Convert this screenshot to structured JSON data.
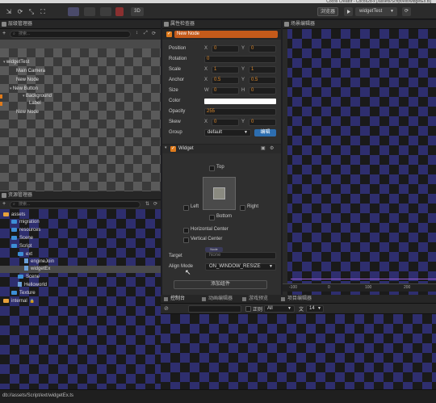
{
  "top_strip": {
    "text": "Cocos Creator - Cocos2d-x [/assets/Script/ext/widgetEx.ts]"
  },
  "toolbar": {
    "buttons": [
      "⇲",
      "⟳",
      "⤡",
      "⛶"
    ],
    "mode_3d": "3D",
    "browser_label": "浏览器",
    "scene_select": "widgetTest",
    "play_icon": "play-icon",
    "refresh_icon": "refresh-icon"
  },
  "hierarchy": {
    "title": "层级管理器",
    "search_placeholder": "搜索...",
    "rows": [
      {
        "label": "widgetTest"
      },
      {
        "label": "Main Camera"
      },
      {
        "label": "New Node"
      },
      {
        "label": "New Button"
      },
      {
        "label": "Background"
      },
      {
        "label": "Label"
      },
      {
        "label": "New Node"
      }
    ]
  },
  "assets": {
    "title": "资源管理器",
    "search_placeholder": "搜索...",
    "rows": [
      {
        "label": "assets"
      },
      {
        "label": "migration"
      },
      {
        "label": "resources"
      },
      {
        "label": "Scene"
      },
      {
        "label": "Script"
      },
      {
        "label": "ext"
      },
      {
        "label": "engineJoin"
      },
      {
        "label": "widgetEx"
      },
      {
        "label": "Scene"
      },
      {
        "label": "Helloworld"
      },
      {
        "label": "Texture"
      },
      {
        "label": "internal"
      }
    ]
  },
  "inspector": {
    "title": "属性检查器",
    "node_name": "New Node",
    "position": {
      "label": "Position",
      "x": "0",
      "y": "0"
    },
    "rotation": {
      "label": "Rotation",
      "value": "0"
    },
    "scale": {
      "label": "Scale",
      "x": "1",
      "y": "1"
    },
    "anchor": {
      "label": "Anchor",
      "x": "0.5",
      "y": "0.5"
    },
    "size": {
      "label": "Size",
      "w": "0",
      "h": "0"
    },
    "color": {
      "label": "Color"
    },
    "opacity": {
      "label": "Opacity",
      "value": "255"
    },
    "skew": {
      "label": "Skew",
      "x": "0",
      "y": "0"
    },
    "group": {
      "label": "Group",
      "value": "default",
      "edit": "编辑"
    },
    "widget": {
      "title": "Widget",
      "top": "Top",
      "left": "Left",
      "right": "Right",
      "bottom": "Bottom",
      "horizontal_center": "Horizontal Center",
      "vertical_center": "Vertical Center",
      "target_label": "Target",
      "target_value": "None",
      "target_tag": "Node",
      "align_mode_label": "Align Mode",
      "align_mode_value": "ON_WINDOW_RESIZE"
    },
    "add_component": "添加组件",
    "axis": {
      "x": "X",
      "y": "Y",
      "w": "W",
      "h": "H"
    }
  },
  "scene": {
    "title": "场景编辑器",
    "ruler": [
      "-100",
      "0",
      "100",
      "200"
    ]
  },
  "console": {
    "tabs": [
      "控制台",
      "动画编辑器",
      "游戏预览",
      "项目编辑器"
    ],
    "filter_placeholder": "",
    "regex_label": "正则",
    "level": "All",
    "font_label": "文",
    "font_size": "14"
  },
  "status": {
    "path": "db://assets/Script/ext/widgetEx.ts"
  },
  "colors": {
    "accent": "#e07b1c",
    "selected": "#4a4a4a",
    "folder": "#3d8fd6"
  }
}
